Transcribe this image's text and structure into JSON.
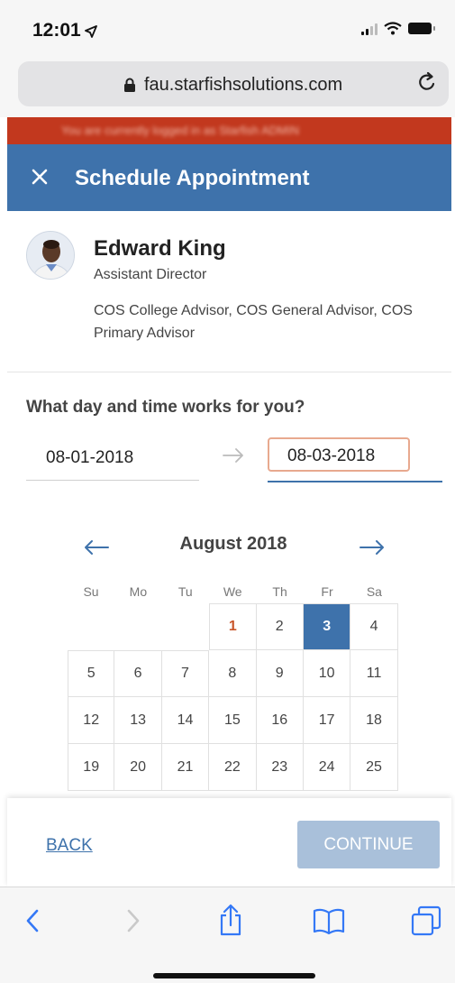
{
  "status_bar": {
    "time": "12:01"
  },
  "browser": {
    "url": "fau.starfishsolutions.com"
  },
  "notice": {
    "text": "You are currently logged in as Starfish ADMIN"
  },
  "header": {
    "title": "Schedule Appointment",
    "close_icon": "close-icon"
  },
  "advisor": {
    "name": "Edward King",
    "title": "Assistant Director",
    "roles": "COS College Advisor, COS General Advisor, COS Primary Advisor"
  },
  "scheduler": {
    "question": "What day and time works for you?",
    "start_date": "08-01-2018",
    "end_date": "08-03-2018"
  },
  "calendar": {
    "month_label": "August 2018",
    "weekdays": [
      "Su",
      "Mo",
      "Tu",
      "We",
      "Th",
      "Fr",
      "Sa"
    ],
    "weeks": [
      [
        "",
        "",
        "",
        "1",
        "2",
        "3",
        "4"
      ],
      [
        "5",
        "6",
        "7",
        "8",
        "9",
        "10",
        "11"
      ],
      [
        "12",
        "13",
        "14",
        "15",
        "16",
        "17",
        "18"
      ],
      [
        "19",
        "20",
        "21",
        "22",
        "23",
        "24",
        "25"
      ]
    ],
    "today": "1",
    "selected": "3",
    "accent_color": "#3e72ab",
    "today_color": "#c8552a"
  },
  "actions": {
    "back_label": "BACK",
    "continue_label": "CONTINUE"
  },
  "toolbar_icons": [
    "back-icon",
    "forward-icon",
    "share-icon",
    "bookmarks-icon",
    "tabs-icon"
  ]
}
